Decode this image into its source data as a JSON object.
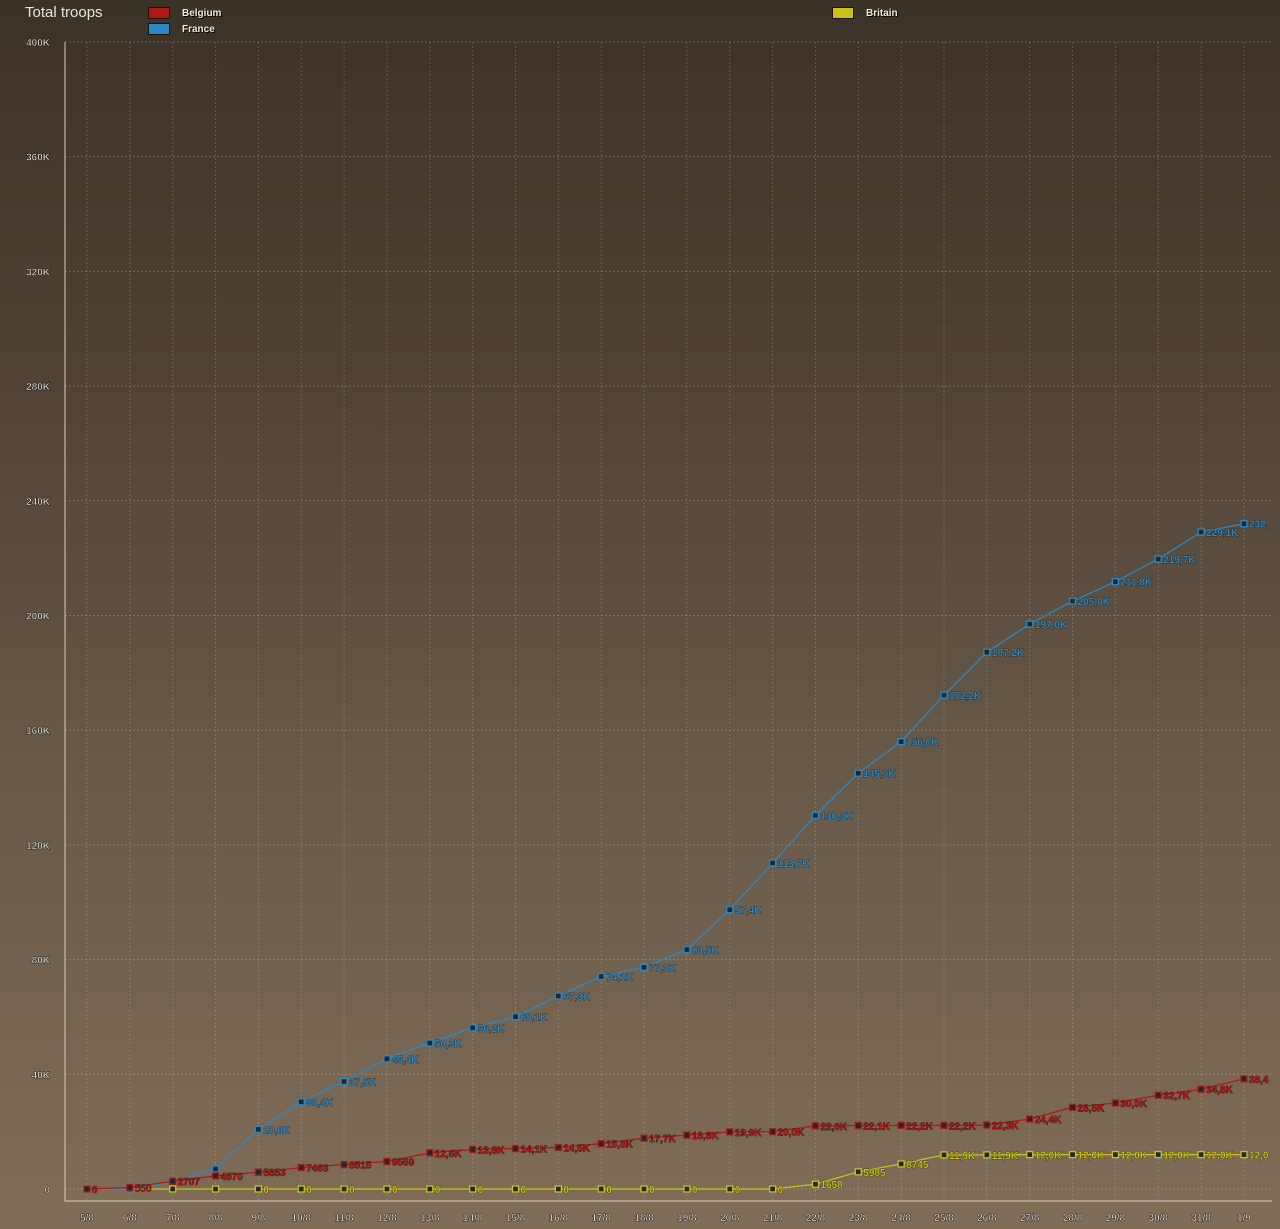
{
  "chart_data": {
    "type": "line",
    "title": "Total troops",
    "categories": [
      "5/8",
      "6/8",
      "7/8",
      "8/8",
      "9/8",
      "10/8",
      "11/8",
      "12/8",
      "13/8",
      "14/8",
      "15/8",
      "16/8",
      "17/8",
      "18/8",
      "19/8",
      "20/8",
      "21/8",
      "22/8",
      "23/8",
      "24/8",
      "25/8",
      "26/8",
      "27/8",
      "28/8",
      "29/8",
      "30/8",
      "31/8",
      "1/9"
    ],
    "ylim": [
      0,
      400000
    ],
    "yticks": [
      0,
      40000,
      80000,
      120000,
      160000,
      200000,
      240000,
      280000,
      320000,
      360000,
      400000
    ],
    "ytick_labels": [
      "0",
      "40K",
      "80K",
      "120K",
      "160K",
      "200K",
      "240K",
      "280K",
      "320K",
      "360K",
      "400K"
    ],
    "grid": true,
    "legend_position": "top-left",
    "series": [
      {
        "name": "Belgium",
        "color": "#b01818",
        "values": [
          0,
          550,
          2707,
          4570,
          5853,
          7463,
          8515,
          9569,
          12600,
          13800,
          14100,
          14500,
          15800,
          17700,
          18800,
          19900,
          20000,
          22000,
          22100,
          22200,
          22200,
          22300,
          24400,
          28500,
          30000,
          32700,
          34800,
          38400
        ],
        "labels": [
          "0",
          "550",
          "2707",
          "4570",
          "5853",
          "7463",
          "8515",
          "9569",
          "12,6K",
          "13,8K",
          "14,1K",
          "14,5K",
          "15,8K",
          "17,7K",
          "18,8K",
          "19,9K",
          "20,0K",
          "22,0K",
          "22,1K",
          "22,2K",
          "22,2K",
          "22,3K",
          "24,4K",
          "28,5K",
          "30,0K",
          "32,7K",
          "34,8K",
          "38,4"
        ]
      },
      {
        "name": "France",
        "color": "#2e88c4",
        "values": [
          0,
          0,
          2500,
          7000,
          20800,
          30400,
          37500,
          45400,
          50900,
          56200,
          60100,
          67300,
          74100,
          77300,
          83500,
          97400,
          113700,
          130300,
          145000,
          156000,
          172200,
          187200,
          197000,
          205000,
          211800,
          219700,
          229100,
          232000
        ],
        "labels": [
          "",
          "",
          "",
          "",
          "20,8K",
          "30,4K",
          "37,5K",
          "45,4K",
          "50,9K",
          "56,2K",
          "60,1K",
          "67,3K",
          "74,1K",
          "77,3K",
          "83,5K",
          "97,4K",
          "113,7K",
          "130,3K",
          "145,0K",
          "156,0K",
          "172,2K",
          "187,2K",
          "197,0K",
          "205,0K",
          "211,8K",
          "219,7K",
          "229,1K",
          "232,"
        ]
      },
      {
        "name": "Britain",
        "color": "#c8c21a",
        "values": [
          0,
          0,
          0,
          0,
          0,
          0,
          0,
          0,
          0,
          0,
          0,
          0,
          0,
          0,
          0,
          0,
          0,
          1658,
          5985,
          8745,
          11900,
          11900,
          12000,
          12000,
          12000,
          12000,
          12000,
          12000
        ],
        "labels": [
          "",
          "",
          "",
          "",
          "0",
          "0",
          "0",
          "0",
          "0",
          "0",
          "0",
          "0",
          "0",
          "0",
          "0",
          "0",
          "0",
          "1658",
          "5985",
          "8745",
          "11,9K",
          "11,9K",
          "12,0K",
          "12,0K",
          "12,0K",
          "12,0K",
          "12,0K",
          "12,0"
        ]
      }
    ]
  }
}
